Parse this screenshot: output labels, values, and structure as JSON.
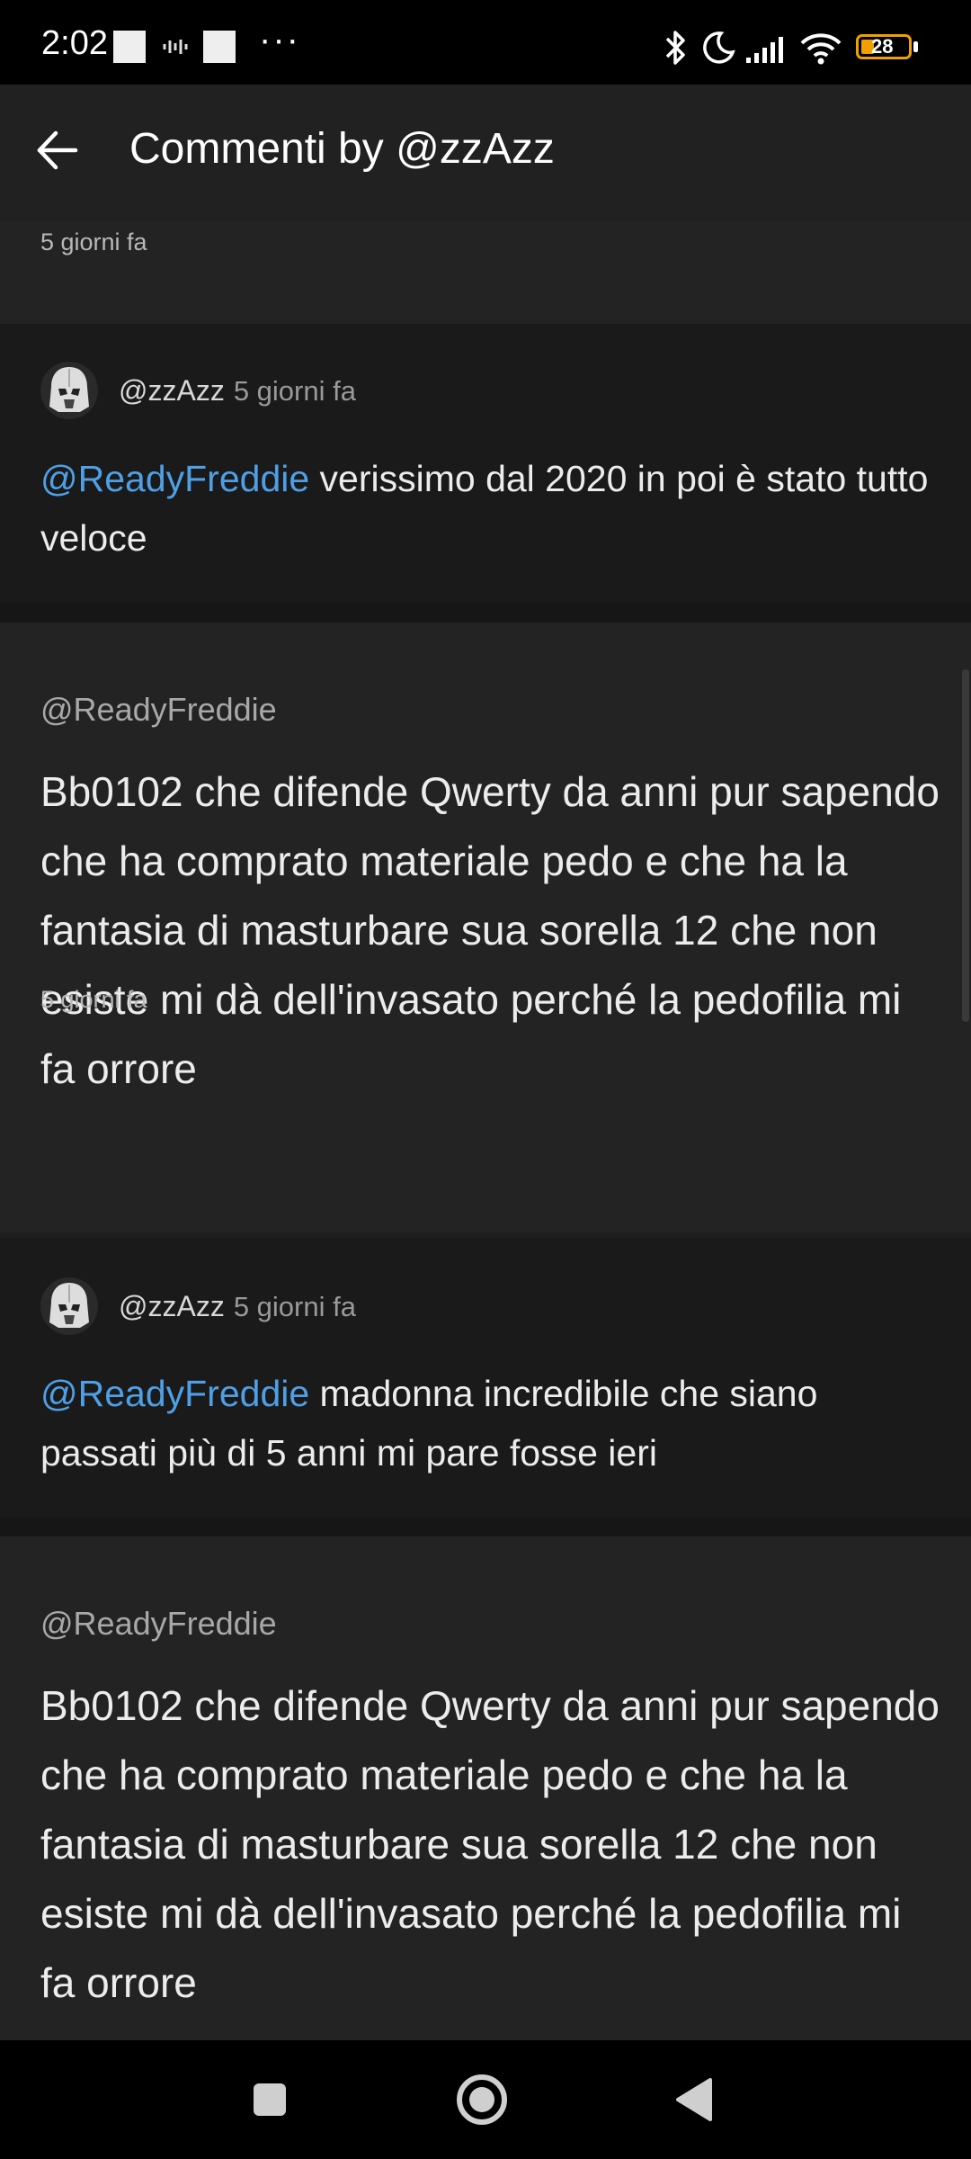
{
  "status_bar": {
    "time": "2:02",
    "battery": "28",
    "icons": [
      "bluetooth-icon",
      "moon-icon",
      "signal-icon",
      "wifi-icon",
      "battery-icon"
    ]
  },
  "app_bar": {
    "title": "Commenti by @zzAzz",
    "back_icon": "arrow-left-icon"
  },
  "feed": {
    "top_partial": {
      "time": "5 giorni fa"
    },
    "threads": [
      {
        "reply": {
          "author": "@zzAzz",
          "time": "5 giorni fa",
          "mention": "@ReadyFreddie",
          "text": " verissimo dal 2020 in poi è stato tutto veloce"
        },
        "parent": {
          "author": "@ReadyFreddie",
          "text": "Bb0102 che difende Qwerty da anni pur sapendo che ha comprato materiale pedo e che ha la fantasia di masturbare sua sorella 12 che non esiste mi dà dell'invasato perché la pedofilia mi fa orrore",
          "time": "5 giorni fa"
        }
      },
      {
        "reply": {
          "author": "@zzAzz",
          "time": "5 giorni fa",
          "mention": "@ReadyFreddie",
          "text": " madonna incredibile che siano passati più di 5 anni mi pare fosse ieri"
        },
        "parent": {
          "author": "@ReadyFreddie",
          "text": "Bb0102 che difende Qwerty da anni pur sapendo che ha comprato materiale pedo e che ha la fantasia di masturbare sua sorella 12 che non esiste mi dà dell'invasato perché la pedofilia mi fa orrore"
        }
      }
    ]
  },
  "nav_bar": {
    "icons": [
      "recents-square-icon",
      "home-circle-icon",
      "back-triangle-icon"
    ]
  }
}
